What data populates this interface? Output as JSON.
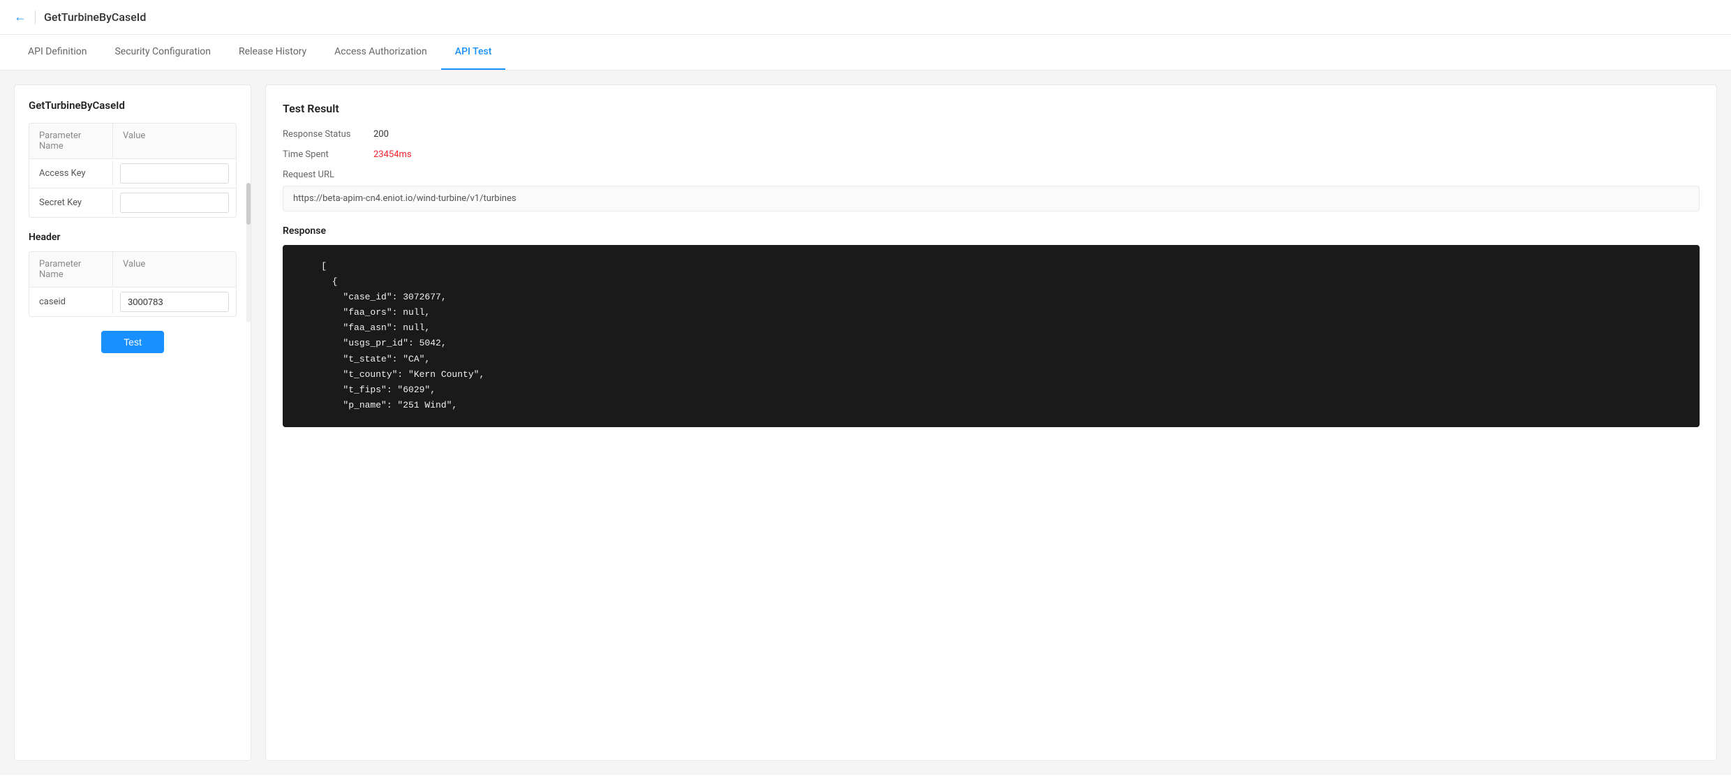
{
  "header": {
    "back_label": "←",
    "title": "GetTurbineByCaseId"
  },
  "tabs": [
    {
      "id": "api-definition",
      "label": "API Definition",
      "active": false
    },
    {
      "id": "security-configuration",
      "label": "Security Configuration",
      "active": false
    },
    {
      "id": "release-history",
      "label": "Release History",
      "active": false
    },
    {
      "id": "access-authorization",
      "label": "Access Authorization",
      "active": false
    },
    {
      "id": "api-test",
      "label": "API Test",
      "active": true
    }
  ],
  "left_panel": {
    "title": "GetTurbineByCaseId",
    "params_table": {
      "header": {
        "col1": "Parameter Name",
        "col2": "Value"
      },
      "rows": []
    },
    "auth_rows": [
      {
        "label": "Access Key",
        "value": ""
      },
      {
        "label": "Secret Key",
        "value": ""
      }
    ],
    "header_section": {
      "title": "Header",
      "table": {
        "header": {
          "col1": "Parameter Name",
          "col2": "Value"
        },
        "rows": [
          {
            "label": "caseid",
            "value": "3000783"
          }
        ]
      }
    },
    "test_button": "Test"
  },
  "right_panel": {
    "title": "Test Result",
    "response_status_label": "Response Status",
    "response_status_value": "200",
    "time_spent_label": "Time Spent",
    "time_spent_value": "23454ms",
    "request_url_label": "Request URL",
    "request_url_value": "https://beta-apim-cn4.eniot.io/wind-turbine/v1/turbines",
    "response_label": "Response",
    "response_code": "    [\n      {\n        \"case_id\": 3072677,\n        \"faa_ors\": null,\n        \"faa_asn\": null,\n        \"usgs_pr_id\": 5042,\n        \"t_state\": \"CA\",\n        \"t_county\": \"Kern County\",\n        \"t_fips\": \"6029\",\n        \"p_name\": \"251 Wind\","
  }
}
